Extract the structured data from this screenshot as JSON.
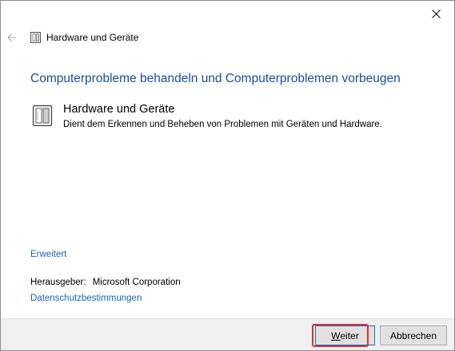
{
  "window": {
    "nav_title": "Hardware und Geräte"
  },
  "main": {
    "heading": "Computerprobleme behandeln und Computerproblemen vorbeugen",
    "task": {
      "title": "Hardware und Geräte",
      "description": "Dient dem Erkennen und Beheben von Problemen mit Geräten und Hardware."
    },
    "advanced_link": "Erweitert",
    "publisher_label": "Herausgeber:",
    "publisher_value": "Microsoft Corporation",
    "privacy_link": "Datenschutzbestimmungen"
  },
  "footer": {
    "next_underlined_char": "W",
    "next_rest": "eiter",
    "cancel_label": "Abbrechen"
  },
  "icons": {
    "close": "close-icon",
    "back": "back-arrow-icon",
    "device": "device-icon"
  },
  "colors": {
    "heading": "#1a4fa0",
    "link": "#1a66b8",
    "highlight": "#e32b2b"
  }
}
